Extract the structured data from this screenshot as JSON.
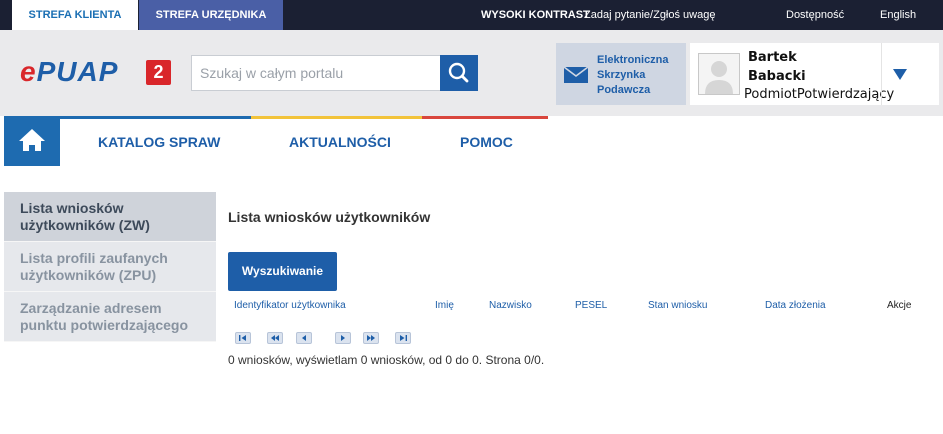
{
  "topbar": {
    "tab_client": "STREFA KLIENTA",
    "tab_official": "STREFA URZĘDNIKA",
    "links": {
      "contrast": "WYSOKI KONTRAST",
      "ask": "Zadaj pytanie/Zgłoś uwagę",
      "accessibility": "Dostępność",
      "language": "English"
    }
  },
  "header": {
    "logo_text": "ePUAP",
    "logo_badge": "2",
    "search_placeholder": "Szukaj w całym portalu",
    "mailbox": {
      "line1": "Elektroniczna",
      "line2": "Skrzynka",
      "line3": "Podawcza"
    },
    "user": {
      "first_name": "Bartek",
      "last_name": "Babacki",
      "role": "PodmiotPotwierdzający"
    }
  },
  "nav": {
    "items": [
      "KATALOG SPRAW",
      "AKTUALNOŚCI",
      "POMOC"
    ],
    "colors": [
      "#1e6bb0",
      "#f2c33a",
      "#d9463d"
    ]
  },
  "sidebar": {
    "items": [
      {
        "label": "Lista wniosków użytkowników (ZW)",
        "active": true
      },
      {
        "label": "Lista profili zaufanych użytkowników (ZPU)",
        "active": false
      },
      {
        "label": "Zarządzanie adresem punktu potwierdzającego",
        "active": false
      }
    ]
  },
  "main": {
    "title": "Lista wniosków użytkowników",
    "search_button": "Wyszukiwanie",
    "columns": [
      "Identyfikator użytkownika",
      "Imię",
      "Nazwisko",
      "PESEL",
      "Stan wniosku",
      "Data złożenia",
      "Akcje"
    ],
    "status": "0 wniosków, wyświetlam 0 wniosków, od 0 do 0. Strona 0/0."
  },
  "colors": {
    "brand_blue": "#1e5ea8",
    "brand_red": "#d9262a",
    "topbar": "#1b2033"
  }
}
